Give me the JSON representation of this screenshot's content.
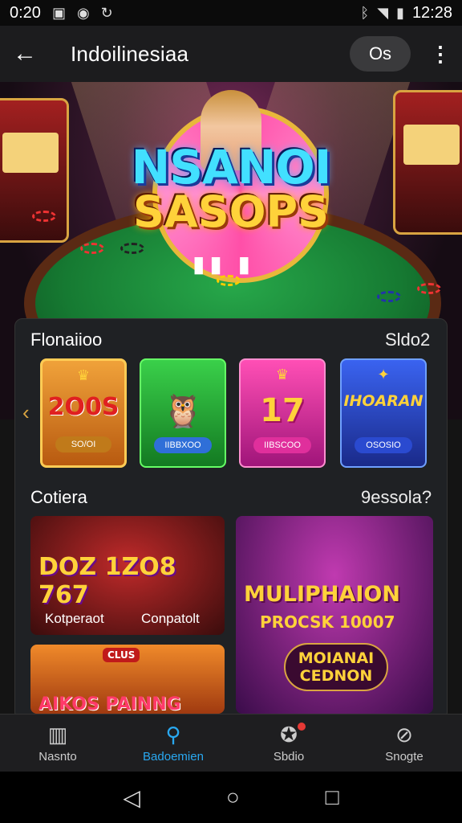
{
  "status_bar": {
    "time_left": "0:20",
    "time_right": "12:28"
  },
  "app_bar": {
    "title": "Indoilinesiaa",
    "pill_label": "Os"
  },
  "hero": {
    "logo_line1": "NSANOI",
    "logo_line2": "SASOPS"
  },
  "section1": {
    "title": "Flonaiioo",
    "link": "Sldo2"
  },
  "games": [
    {
      "big": "2O0S",
      "pill": "SO/OI",
      "color": "#e08a1a"
    },
    {
      "big": "",
      "pill": "IIBBXOO",
      "color": "#2dbb3a"
    },
    {
      "big": "17",
      "pill": "IIBSCOO",
      "color": "#d62f9c"
    },
    {
      "big": "IHOARAN",
      "pill": "OSOSIO",
      "color": "#2c4fd8"
    }
  ],
  "section2": {
    "title": "Cotiera",
    "link": "9essola?"
  },
  "promos": [
    {
      "title": "DOZ 1ZO8 767",
      "caption_left": "Kotperaot",
      "caption_right": "Conpatolt"
    },
    {
      "title": "MULIPHAION",
      "subtitle": "PROCSK 10007",
      "badge": "MOIANAI CEDNON"
    },
    {
      "title": "AIKOS PAINNG",
      "tag": "CLUS"
    }
  ],
  "bottom_nav": [
    {
      "label": "Nasnto",
      "icon": "book-icon",
      "active": false
    },
    {
      "label": "Badoemien",
      "icon": "search-icon",
      "active": true
    },
    {
      "label": "Sbdio",
      "icon": "gamepad-icon",
      "active": false
    },
    {
      "label": "Snogte",
      "icon": "compass-icon",
      "active": false
    }
  ]
}
